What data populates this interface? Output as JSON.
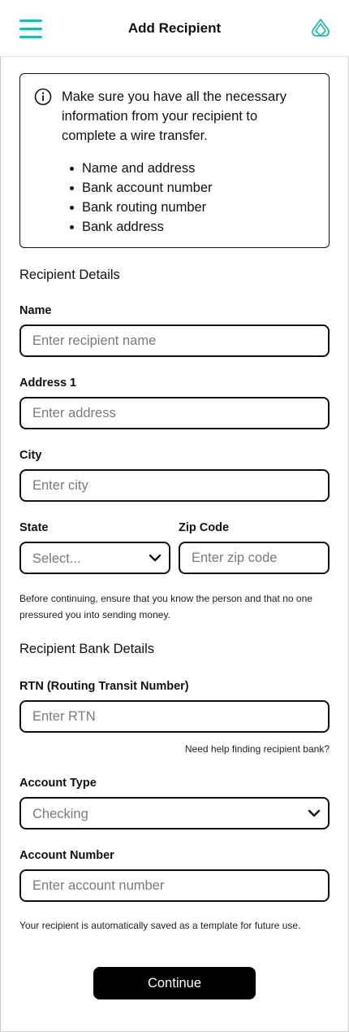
{
  "header": {
    "title": "Add Recipient",
    "menu_icon": "hamburger-menu-icon",
    "logo_icon": "brand-logo-icon"
  },
  "colors": {
    "accent": "#1fb9ad",
    "text": "#111111",
    "placeholder": "#7a7a7a",
    "button_bg": "#000000",
    "button_text": "#ffffff"
  },
  "info": {
    "icon": "info-icon",
    "message": "Make sure you have all the necessary information from your recipient to complete a wire transfer.",
    "items": [
      "Name and address",
      "Bank account number",
      "Bank routing number",
      "Bank address"
    ]
  },
  "recipient_details": {
    "title": "Recipient Details",
    "name": {
      "label": "Name",
      "placeholder": "Enter recipient name"
    },
    "address1": {
      "label": "Address 1",
      "placeholder": "Enter address"
    },
    "city": {
      "label": "City",
      "placeholder": "Enter city"
    },
    "state": {
      "label": "State",
      "value": "Select..."
    },
    "zip": {
      "label": "Zip Code",
      "placeholder": "Enter zip code"
    },
    "note": "Before continuing, ensure that you know the person and that no one pressured you into sending money."
  },
  "bank_details": {
    "title": "Recipient Bank Details",
    "rtn": {
      "label": "RTN (Routing Transit Number)",
      "placeholder": "Enter RTN"
    },
    "help_link": "Need help finding recipient bank?",
    "account_type": {
      "label": "Account Type",
      "value": "Checking"
    },
    "account_number": {
      "label": "Account Number",
      "placeholder": "Enter account number"
    },
    "note": "Your recipient is automatically saved as a template for future use."
  },
  "actions": {
    "continue_label": "Continue"
  }
}
